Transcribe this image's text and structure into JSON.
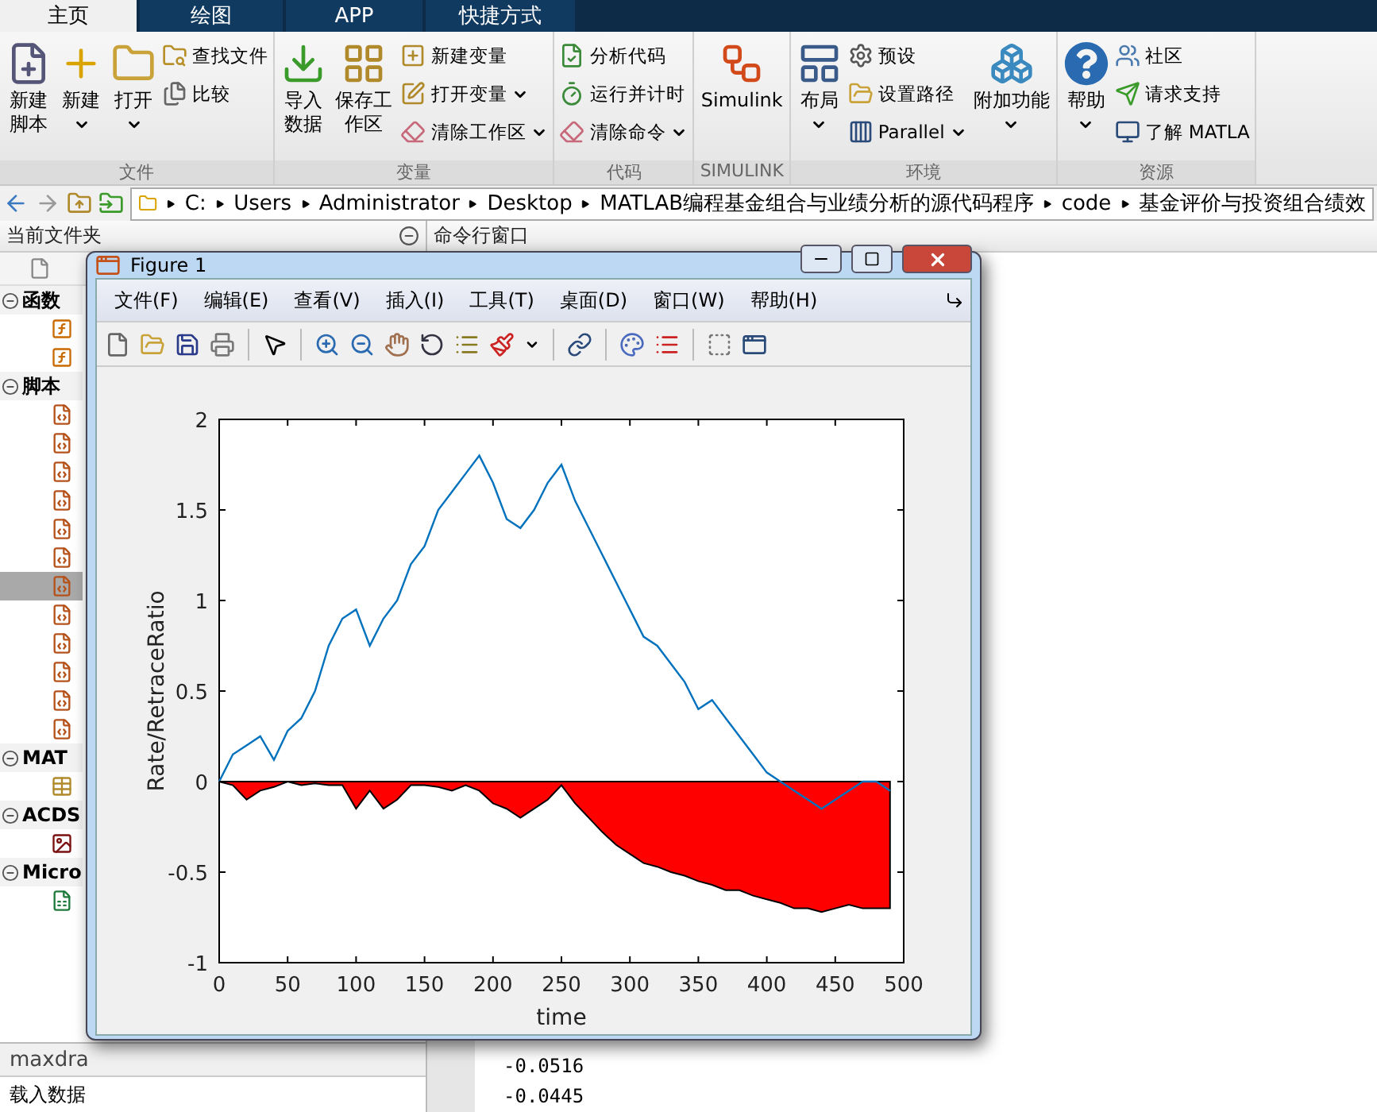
{
  "tabs": [
    {
      "label": "主页",
      "selected": true
    },
    {
      "label": "绘图",
      "selected": false
    },
    {
      "label": "APP",
      "selected": false
    },
    {
      "label": "快捷方式",
      "selected": false
    }
  ],
  "ribbon": {
    "groups": [
      {
        "label": "文件",
        "items": [
          {
            "kind": "large",
            "label": "新建脚本",
            "dropdown": false
          },
          {
            "kind": "large",
            "label": "新建",
            "dropdown": true
          },
          {
            "kind": "large",
            "label": "打开",
            "dropdown": true
          },
          {
            "kind": "small",
            "label": "查找文件",
            "dropdown": false
          },
          {
            "kind": "small",
            "label": "比较",
            "dropdown": false
          }
        ]
      },
      {
        "label": "变量",
        "items": [
          {
            "kind": "large",
            "label": "导入数据",
            "dropdown": false
          },
          {
            "kind": "large",
            "label": "保存工作区",
            "dropdown": false
          },
          {
            "kind": "small",
            "label": "新建变量",
            "dropdown": false
          },
          {
            "kind": "small",
            "label": "打开变量",
            "dropdown": true
          },
          {
            "kind": "small",
            "label": "清除工作区",
            "dropdown": true
          }
        ]
      },
      {
        "label": "代码",
        "items": [
          {
            "kind": "small",
            "label": "分析代码",
            "dropdown": false
          },
          {
            "kind": "small",
            "label": "运行并计时",
            "dropdown": false
          },
          {
            "kind": "small",
            "label": "清除命令",
            "dropdown": true
          }
        ]
      },
      {
        "label": "SIMULINK",
        "items": [
          {
            "kind": "large",
            "label": "Simulink",
            "dropdown": false
          }
        ]
      },
      {
        "label": "环境",
        "items": [
          {
            "kind": "large",
            "label": "布局",
            "dropdown": true
          },
          {
            "kind": "small",
            "label": "预设",
            "dropdown": false
          },
          {
            "kind": "small",
            "label": "设置路径",
            "dropdown": false
          },
          {
            "kind": "small",
            "label": "Parallel",
            "dropdown": true
          },
          {
            "kind": "large",
            "label": "附加功能",
            "dropdown": true
          }
        ]
      },
      {
        "label": "资源",
        "items": [
          {
            "kind": "large",
            "label": "帮助",
            "dropdown": true
          },
          {
            "kind": "small",
            "label": "社区",
            "dropdown": false
          },
          {
            "kind": "small",
            "label": "请求支持",
            "dropdown": false
          },
          {
            "kind": "small",
            "label": "了解 MATLA",
            "dropdown": false
          }
        ]
      }
    ]
  },
  "address": {
    "path": [
      "C:",
      "Users",
      "Administrator",
      "Desktop",
      "MATLAB编程基金组合与业绩分析的源代码程序",
      "code",
      "基金评价与投资组合绩效"
    ]
  },
  "current_folder": {
    "title": "当前文件夹",
    "groups": [
      {
        "label": "函数",
        "expanded": true,
        "items": [
          {
            "kind": "function",
            "selected": false
          },
          {
            "kind": "function",
            "selected": false
          }
        ]
      },
      {
        "label": "脚本",
        "expanded": true,
        "items": [
          {
            "kind": "script",
            "selected": false
          },
          {
            "kind": "script",
            "selected": false
          },
          {
            "kind": "script",
            "selected": false
          },
          {
            "kind": "script",
            "selected": false
          },
          {
            "kind": "script",
            "selected": false
          },
          {
            "kind": "script",
            "selected": false
          },
          {
            "kind": "script",
            "selected": true
          },
          {
            "kind": "script",
            "selected": false
          },
          {
            "kind": "script",
            "selected": false
          },
          {
            "kind": "script",
            "selected": false
          },
          {
            "kind": "script",
            "selected": false
          },
          {
            "kind": "script",
            "selected": false
          }
        ]
      },
      {
        "label": "MAT",
        "expanded": true,
        "items": [
          {
            "kind": "mat",
            "selected": false
          }
        ]
      },
      {
        "label": "ACDS",
        "expanded": true,
        "items": [
          {
            "kind": "image",
            "selected": false
          }
        ]
      },
      {
        "label": "Micro",
        "expanded": true,
        "items": [
          {
            "kind": "excel",
            "selected": false
          }
        ]
      }
    ],
    "detail": {
      "title": "maxdra",
      "text": "载入数据"
    }
  },
  "command_window": {
    "title": "命令行窗口",
    "lines": [
      "-0.0516",
      "-0.0445"
    ]
  },
  "figure": {
    "title": "Figure 1",
    "menu": [
      "文件(F)",
      "编辑(E)",
      "查看(V)",
      "插入(I)",
      "工具(T)",
      "桌面(D)",
      "窗口(W)",
      "帮助(H)"
    ],
    "chart_data": {
      "type": "line",
      "xlabel": "time",
      "ylabel": "Rate/RetraceRatio",
      "x": [
        0,
        10,
        20,
        30,
        40,
        50,
        60,
        70,
        80,
        90,
        100,
        110,
        120,
        130,
        140,
        150,
        160,
        170,
        180,
        190,
        200,
        210,
        220,
        230,
        240,
        250,
        260,
        270,
        280,
        290,
        300,
        310,
        320,
        330,
        340,
        350,
        360,
        370,
        380,
        390,
        400,
        410,
        420,
        430,
        440,
        450,
        460,
        470,
        480,
        490
      ],
      "series": [
        {
          "type": "line",
          "color": "#0072bd",
          "values": [
            0,
            0.15,
            0.2,
            0.25,
            0.12,
            0.28,
            0.35,
            0.5,
            0.75,
            0.9,
            0.95,
            0.75,
            0.9,
            1.0,
            1.2,
            1.3,
            1.5,
            1.6,
            1.7,
            1.8,
            1.65,
            1.45,
            1.4,
            1.5,
            1.65,
            1.75,
            1.55,
            1.4,
            1.25,
            1.1,
            0.95,
            0.8,
            0.75,
            0.65,
            0.55,
            0.4,
            0.45,
            0.35,
            0.25,
            0.15,
            0.05,
            0.0,
            -0.05,
            -0.1,
            -0.15,
            -0.1,
            -0.05,
            0.0,
            0.0,
            -0.05
          ]
        },
        {
          "type": "area",
          "color": "#ff0000",
          "values": [
            0,
            -0.02,
            -0.1,
            -0.05,
            -0.03,
            0,
            -0.02,
            -0.01,
            -0.02,
            -0.02,
            -0.15,
            -0.05,
            -0.15,
            -0.1,
            -0.02,
            -0.02,
            -0.03,
            -0.05,
            -0.02,
            -0.05,
            -0.12,
            -0.15,
            -0.2,
            -0.15,
            -0.1,
            -0.02,
            -0.12,
            -0.2,
            -0.28,
            -0.35,
            -0.4,
            -0.45,
            -0.47,
            -0.5,
            -0.52,
            -0.55,
            -0.57,
            -0.6,
            -0.6,
            -0.63,
            -0.65,
            -0.67,
            -0.7,
            -0.7,
            -0.72,
            -0.7,
            -0.68,
            -0.7,
            -0.7,
            -0.7
          ]
        }
      ],
      "xlim": [
        0,
        500
      ],
      "ylim": [
        -1,
        2
      ],
      "xticks": [
        0,
        50,
        100,
        150,
        200,
        250,
        300,
        350,
        400,
        450,
        500
      ],
      "yticks": [
        -1,
        -0.5,
        0,
        0.5,
        1,
        1.5,
        2
      ]
    }
  }
}
